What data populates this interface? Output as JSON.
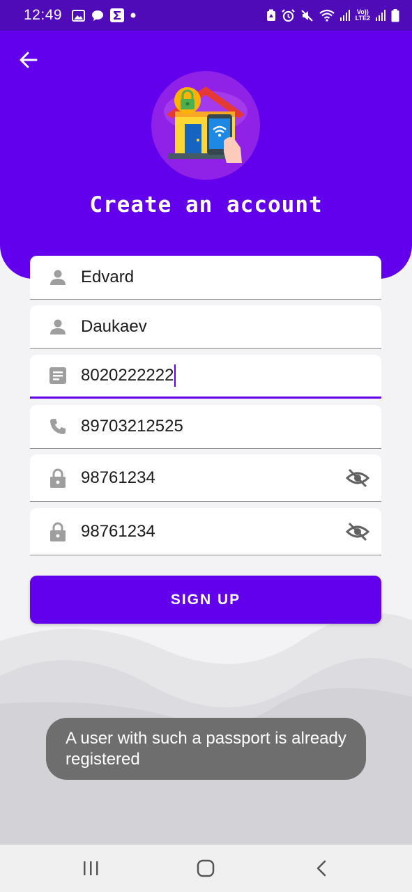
{
  "status_bar": {
    "time": "12:49",
    "left_icons": [
      "image-icon",
      "chat-bubble-icon",
      "sigma-icon",
      "dot-icon"
    ],
    "right_icons": [
      "recycle-icon",
      "alarm-icon",
      "mute-icon",
      "wifi-icon",
      "signal-icon",
      "volte-lte2-icon",
      "signal-icon",
      "battery-icon"
    ],
    "volte_label": "Vo))",
    "lte_label": "LTE2"
  },
  "header": {
    "title": "Create an account",
    "back_icon": "arrow-left-icon",
    "logo": "smart-home-lock-logo"
  },
  "form": {
    "first_name": {
      "value": "Edvard",
      "icon": "person-icon"
    },
    "last_name": {
      "value": "Daukaev",
      "icon": "person-icon"
    },
    "passport": {
      "value": "8020222222",
      "icon": "document-icon"
    },
    "phone": {
      "value": "89703212525",
      "icon": "phone-icon"
    },
    "password": {
      "value": "98761234",
      "icon": "lock-icon",
      "toggle_icon": "eye-off-icon"
    },
    "confirm_password": {
      "value": "98761234",
      "icon": "lock-icon",
      "toggle_icon": "eye-off-icon"
    }
  },
  "signup_button": {
    "label": "SIGN UP"
  },
  "toast": {
    "message": "A user with such a passport is already registered"
  },
  "nav_bar": {
    "icons": [
      "recent-apps-icon",
      "home-icon",
      "back-icon"
    ]
  },
  "colors": {
    "primary": "#6200ee",
    "status_bar": "#4f0bb8",
    "background": "#f3f3f5",
    "toast": "#6e6e6e"
  }
}
